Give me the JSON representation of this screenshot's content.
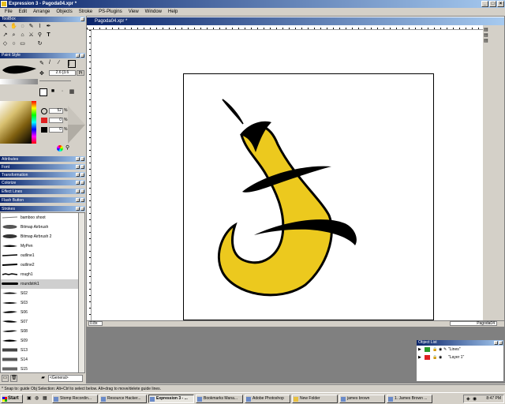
{
  "window": {
    "title": "Expression 3 - Pagoda04.xpr *"
  },
  "menu": [
    "File",
    "Edit",
    "Arrange",
    "Objects",
    "Stroke",
    "PS-Plugins",
    "View",
    "Window",
    "Help"
  ],
  "toolbox": {
    "title": "ToolBox"
  },
  "paint_style": {
    "title": "Paint Style",
    "width_value": "2.6 [3.6",
    "unit": "Pt",
    "opacity_value": "52",
    "red_value": "0",
    "black_value": "0",
    "percent": "%"
  },
  "collapsed_panels": [
    "Attributes",
    "Font",
    "Transformation",
    "Colorize",
    "Effect Lines",
    "Flash Button",
    "Strokes"
  ],
  "strokes": {
    "items": [
      "bamboo shoot",
      "Bitmap Airbrush",
      "Bitmap Airbrush 2",
      "MyPen",
      "outline1",
      "outline2",
      "rough1",
      "roundstrk1",
      "S02",
      "S03",
      "S06",
      "S07",
      "S08",
      "S09",
      "S13",
      "S14",
      "S15"
    ],
    "selected": "roundstrk1",
    "category": "<General>"
  },
  "document": {
    "title": "Pagoda04.xpr *",
    "zoom": "0.8x",
    "object_name": "Pagoda04"
  },
  "object_list": {
    "title": "Object List",
    "layers": [
      {
        "name": "\"Lines\"",
        "color": "#2a9a2a"
      },
      {
        "name": "\"Layer 1\"",
        "color": "#e02020"
      }
    ]
  },
  "status": "* Snap to: guide     Obj Selection: Alt+Ctrl to select below. Alt+drag to move/delete guide lines.",
  "taskbar": {
    "start": "Start",
    "tasks": [
      "Stomp Recordin...",
      "Resource Hacker...",
      "Expression 3 - ...",
      "Bookmarks Mana...",
      "Adobe Photoshop",
      "New Folder",
      "james brown",
      "1. James Brown ..."
    ],
    "active_index": 2,
    "clock": "8:47 PM"
  },
  "colors": {
    "accent": "#0a246a",
    "fill_yellow": "#ecc91e",
    "stroke_black": "#000000"
  }
}
